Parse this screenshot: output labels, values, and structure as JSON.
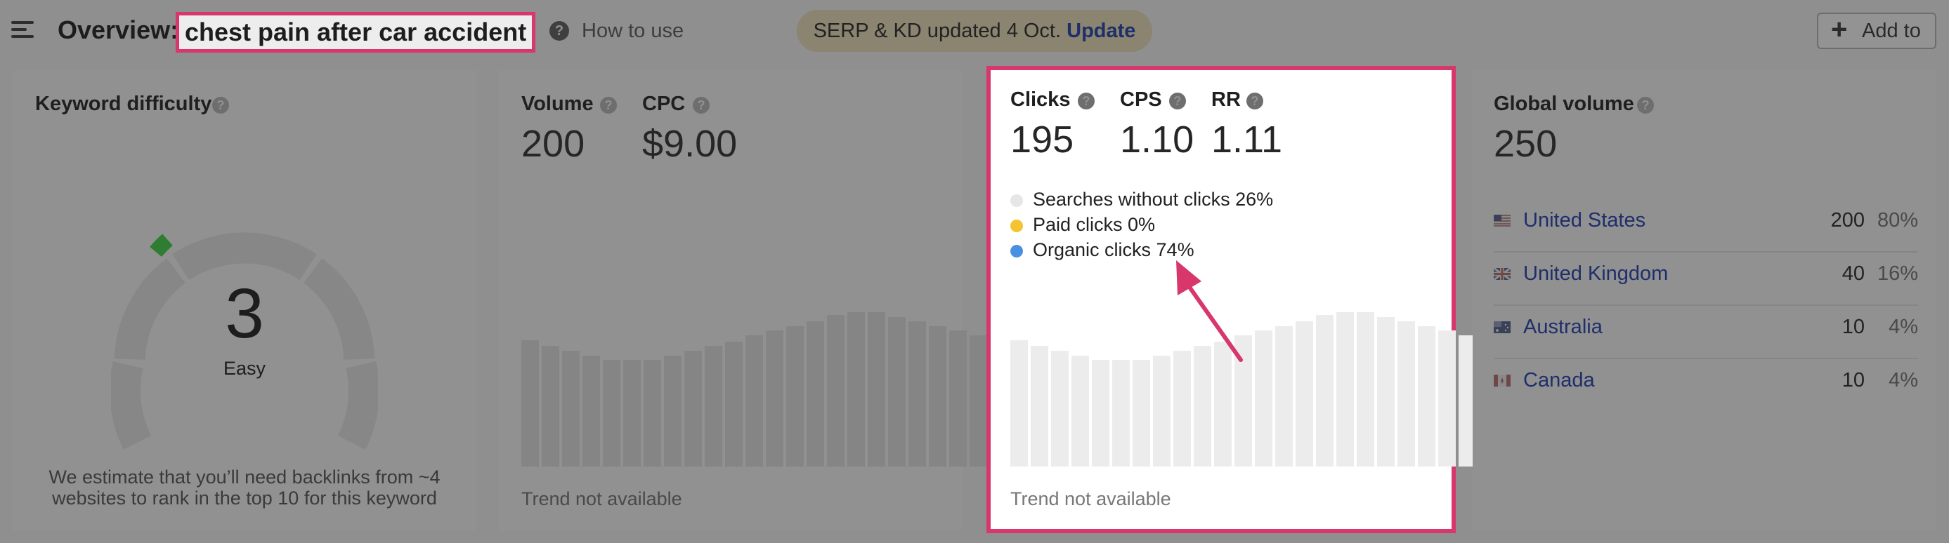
{
  "header": {
    "overview_label": "Overview:",
    "keyword": "chest pain after car accident",
    "how_to_use": "How to use",
    "serp_text": "SERP & KD updated 4 Oct.",
    "serp_update": "Update",
    "add_to": "Add to"
  },
  "kd_card": {
    "title": "Keyword difficulty",
    "value": "3",
    "label": "Easy",
    "note": "We estimate that you’ll need backlinks from ~4 websites to rank in the top 10 for this keyword",
    "difficulty": 3
  },
  "volume_card": {
    "volume_title": "Volume",
    "volume_value": "200",
    "cpc_title": "CPC",
    "cpc_value": "$9.00",
    "trend_note": "Trend not available"
  },
  "clicks_card": {
    "clicks_title": "Clicks",
    "clicks_value": "195",
    "cps_title": "CPS",
    "cps_value": "1.10",
    "rr_title": "RR",
    "rr_value": "1.11",
    "legend": [
      {
        "label": "Searches without clicks 26%",
        "color": "#e6e6e6"
      },
      {
        "label": "Paid clicks 0%",
        "color": "#f4c430"
      },
      {
        "label": "Organic clicks 74%",
        "color": "#4a90e2"
      }
    ],
    "trend_note": "Trend not available"
  },
  "global_card": {
    "title": "Global volume",
    "value": "250",
    "countries": [
      {
        "name": "United States",
        "volume": "200",
        "pct": "80%",
        "flag": "us"
      },
      {
        "name": "United Kingdom",
        "volume": "40",
        "pct": "16%",
        "flag": "uk"
      },
      {
        "name": "Australia",
        "volume": "10",
        "pct": "4%",
        "flag": "au"
      },
      {
        "name": "Canada",
        "volume": "10",
        "pct": "4%",
        "flag": "ca"
      }
    ]
  },
  "trend_placeholder_levels": [
    0.82,
    0.78,
    0.75,
    0.72,
    0.69,
    0.69,
    0.69,
    0.72,
    0.75,
    0.78,
    0.81,
    0.85,
    0.88,
    0.91,
    0.94,
    0.98,
    1.0,
    1.0,
    0.97,
    0.94,
    0.91,
    0.88,
    0.85,
    0.82
  ],
  "colors": {
    "highlight": "#d7376b",
    "link": "#1e2f6a",
    "kd_green": "#2e7d32"
  }
}
